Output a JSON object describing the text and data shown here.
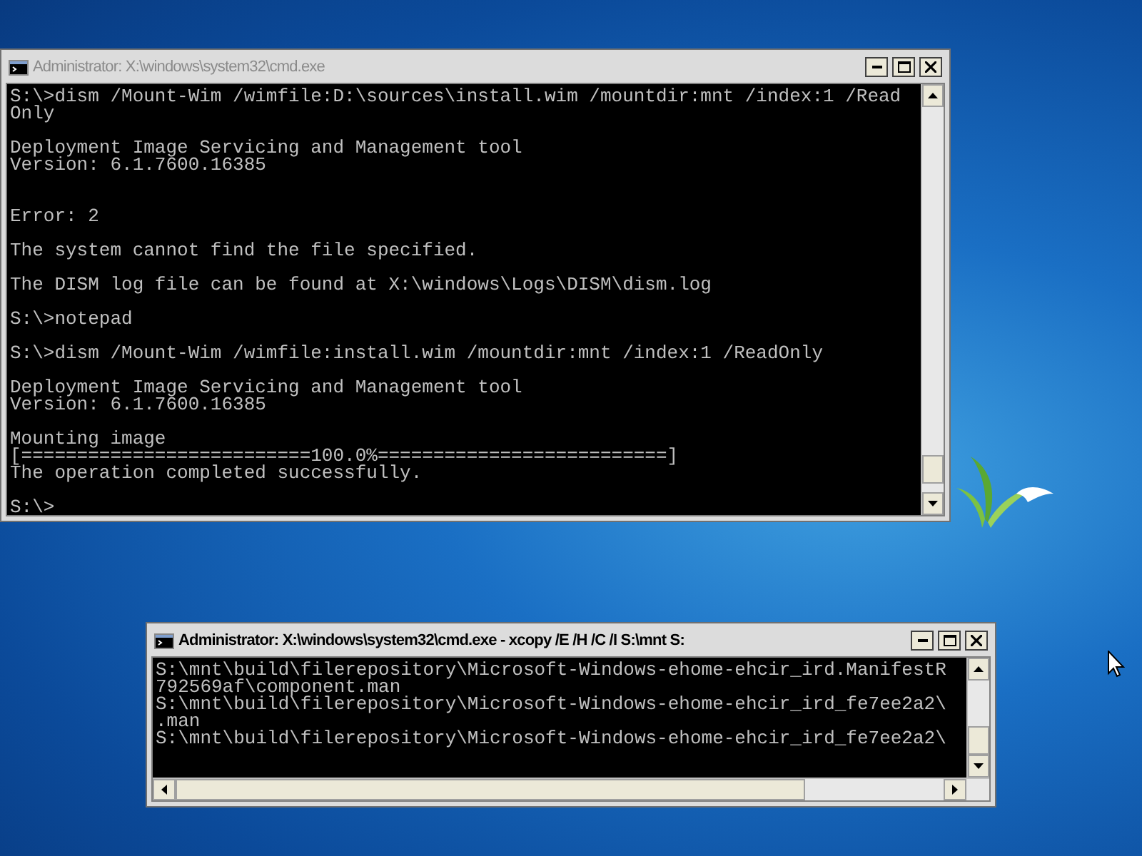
{
  "windows": [
    {
      "title": "Administrator: X:\\windows\\system32\\cmd.exe",
      "active": false,
      "lines": [
        {
          "kind": "text",
          "text": "S:\\>dism /Mount-Wim /wimfile:D:\\sources\\install.wim /mountdir:mnt /index:1 /Read"
        },
        {
          "kind": "text",
          "text": "Only"
        },
        {
          "kind": "blank"
        },
        {
          "kind": "text",
          "text": "Deployment Image Servicing and Management tool"
        },
        {
          "kind": "text",
          "text": "Version: 6.1.7600.16385"
        },
        {
          "kind": "blank"
        },
        {
          "kind": "blank"
        },
        {
          "kind": "text",
          "text": "Error: 2"
        },
        {
          "kind": "blank"
        },
        {
          "kind": "text",
          "text": "The system cannot find the file specified."
        },
        {
          "kind": "blank"
        },
        {
          "kind": "text",
          "text": "The DISM log file can be found at X:\\windows\\Logs\\DISM\\dism.log"
        },
        {
          "kind": "blank"
        },
        {
          "kind": "text",
          "text": "S:\\>notepad"
        },
        {
          "kind": "blank"
        },
        {
          "kind": "text",
          "text": "S:\\>dism /Mount-Wim /wimfile:install.wim /mountdir:mnt /index:1 /ReadOnly"
        },
        {
          "kind": "blank"
        },
        {
          "kind": "text",
          "text": "Deployment Image Servicing and Management tool"
        },
        {
          "kind": "text",
          "text": "Version: 6.1.7600.16385"
        },
        {
          "kind": "blank"
        },
        {
          "kind": "text",
          "text": "Mounting image"
        },
        {
          "kind": "text",
          "text": "[==========================100.0%==========================]"
        },
        {
          "kind": "text",
          "text": "The operation completed successfully."
        },
        {
          "kind": "blank"
        },
        {
          "kind": "text",
          "text": "S:\\>"
        }
      ]
    },
    {
      "title": "Administrator: X:\\windows\\system32\\cmd.exe - xcopy  /E /H /C /I S:\\mnt S:",
      "active": true,
      "lines": [
        {
          "kind": "text",
          "text": "S:\\mnt\\build\\filerepository\\Microsoft-Windows-ehome-ehcir_ird.ManifestR"
        },
        {
          "kind": "text",
          "text": "792569af\\component.man"
        },
        {
          "kind": "text",
          "text": "S:\\mnt\\build\\filerepository\\Microsoft-Windows-ehome-ehcir_ird_fe7ee2a2\\"
        },
        {
          "kind": "text",
          "text": ".man"
        },
        {
          "kind": "text",
          "text": "S:\\mnt\\build\\filerepository\\Microsoft-Windows-ehome-ehcir_ird_fe7ee2a2\\"
        }
      ]
    }
  ]
}
